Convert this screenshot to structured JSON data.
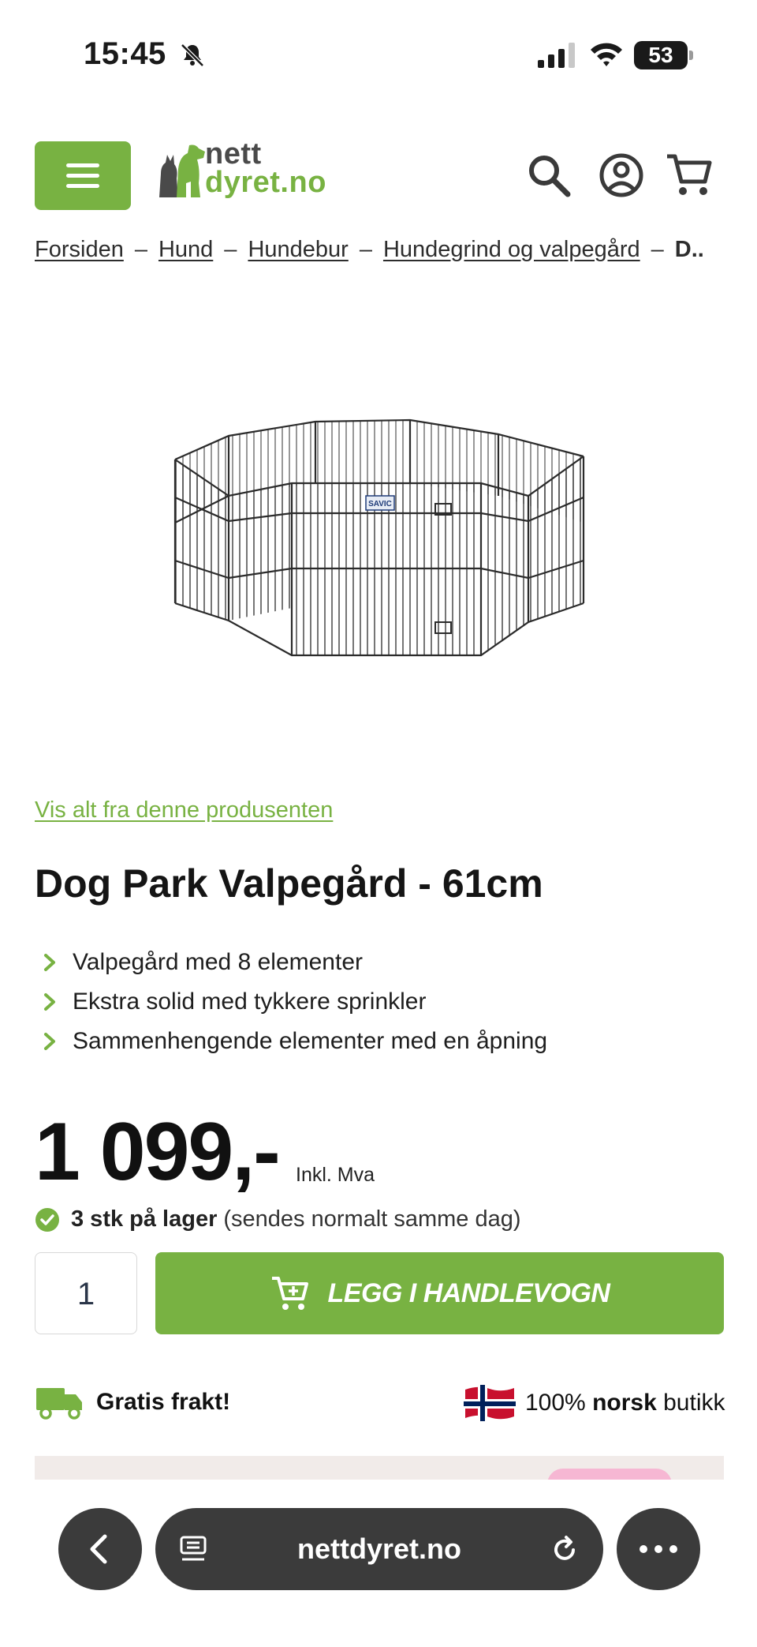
{
  "status_bar": {
    "time": "15:45",
    "battery": "53"
  },
  "header": {
    "logo_line1": "nett",
    "logo_line2": "dyret.no"
  },
  "breadcrumb": {
    "items": [
      "Forsiden",
      "Hund",
      "Hundebur",
      "Hundegrind og valpegård"
    ],
    "separator": "–",
    "current": "D.."
  },
  "product": {
    "image_brand_label": "SAVIC",
    "brand_link": "Vis alt fra denne produsenten",
    "title": "Dog Park Valpegård - 61cm",
    "features": [
      "Valpegård med 8 elementer",
      "Ekstra solid med tykkere sprinkler",
      "Sammenhengende elementer med en åpning"
    ],
    "price": "1 099,-",
    "vat_note": "Inkl. Mva",
    "stock_bold": "3 stk på lager",
    "stock_note": "(sendes normalt samme dag)",
    "quantity": "1",
    "add_to_cart": "LEGG I HANDLEVOGN"
  },
  "usp": {
    "shipping": "Gratis frakt!",
    "norsk_prefix": "100%",
    "norsk_bold": "norsk",
    "norsk_suffix": "butikk"
  },
  "browser": {
    "url": "nettdyret.no"
  },
  "colors": {
    "brand_green": "#78b242",
    "dark_gray": "#3b3b3b",
    "promo_pink": "#f6b7d3"
  }
}
